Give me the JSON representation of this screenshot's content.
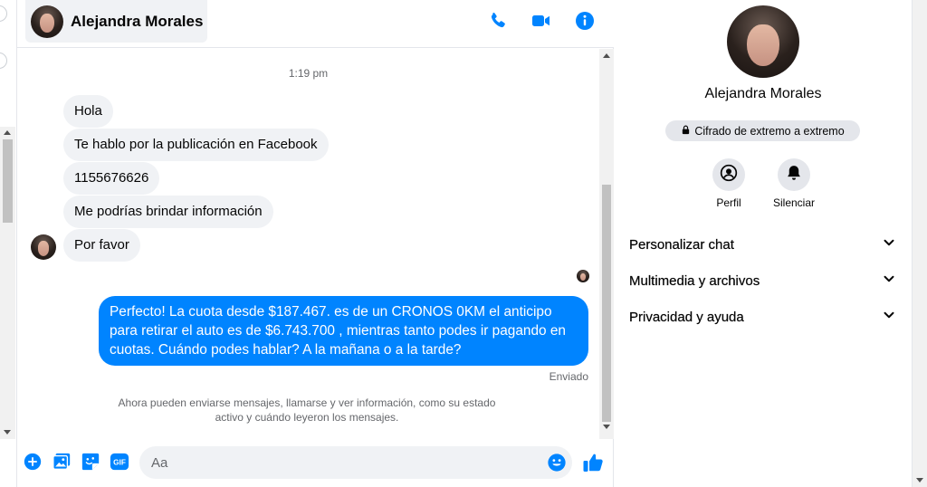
{
  "header": {
    "contact_name": "Alejandra Morales",
    "icons": [
      "phone-icon",
      "video-camera-icon",
      "info-icon"
    ]
  },
  "conversation": {
    "timestamp": "1:19 pm",
    "incoming": [
      "Hola",
      "Te hablo por la publicación en Facebook",
      "1155676626",
      "Me podrías brindar información",
      "Por favor"
    ],
    "outgoing": "Perfecto! La cuota desde $187.467. es de un CRONOS 0KM el anticipo para retirar el auto es de $6.743.700 , mientras tanto podes ir pagando en cuotas. Cuándo podes hablar? A la mañana o a la tarde?",
    "status": "Enviado",
    "notice": "Ahora pueden enviarse mensajes, llamarse y ver información, como su estado activo y cuándo leyeron los mensajes."
  },
  "composer": {
    "placeholder": "Aa",
    "tools": [
      "plus-circle-icon",
      "photo-icon",
      "sticker-icon",
      "gif-icon",
      "emoji-icon",
      "thumbs-up-icon"
    ],
    "gif_label": "GIF"
  },
  "details": {
    "name": "Alejandra Morales",
    "encryption": "Cifrado de extremo a extremo",
    "actions": [
      {
        "label": "Perfil",
        "icon": "profile-icon"
      },
      {
        "label": "Silenciar",
        "icon": "bell-icon"
      }
    ],
    "sections": [
      "Personalizar chat",
      "Multimedia y archivos",
      "Privacidad y ayuda"
    ]
  },
  "colors": {
    "accent": "#0084ff",
    "bubble_in": "#f0f2f5",
    "secondary_text": "#65676b"
  }
}
